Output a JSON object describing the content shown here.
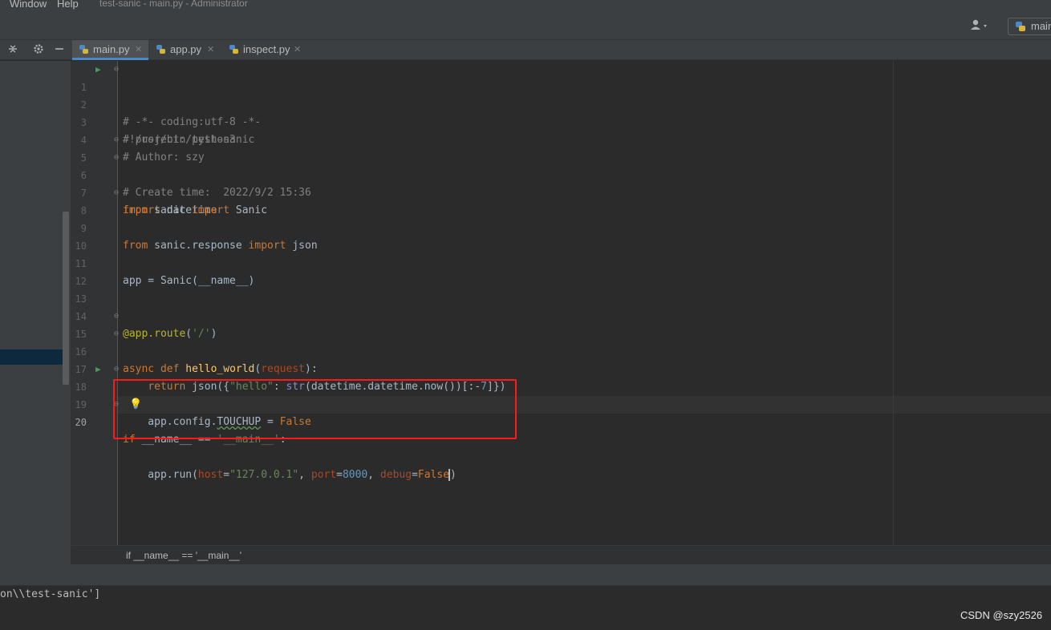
{
  "menu": {
    "window": "Window",
    "help": "Help"
  },
  "window_title": "test-sanic - main.py - Administrator",
  "toolbar": {
    "run_config": "main"
  },
  "tabs": [
    {
      "label": "main.py",
      "active": true
    },
    {
      "label": "app.py",
      "active": false
    },
    {
      "label": "inspect.py",
      "active": false
    }
  ],
  "editor": {
    "lines": [
      {
        "n": "1",
        "text": "#!/usr/bin/python3"
      },
      {
        "n": "2",
        "text": "# -*- coding:utf-8 -*-"
      },
      {
        "n": "3",
        "text": "# project: test-sanic"
      },
      {
        "n": "4",
        "text": "# Author: szy"
      },
      {
        "n": "5",
        "text": "# Create time:  2022/9/2 15:36"
      },
      {
        "n": "6",
        "text": "import datetime"
      },
      {
        "n": "7",
        "text": "from sanic import Sanic"
      },
      {
        "n": "8",
        "text": "from sanic.response import json"
      },
      {
        "n": "9",
        "text": ""
      },
      {
        "n": "10",
        "text": ""
      },
      {
        "n": "11",
        "text": "app = Sanic(__name__)"
      },
      {
        "n": "12",
        "text": ""
      },
      {
        "n": "13",
        "text": ""
      },
      {
        "n": "14",
        "text": "@app.route('/')"
      },
      {
        "n": "15",
        "text": "async def hello_world(request):"
      },
      {
        "n": "16",
        "text": "    return json({\"hello\": str(datetime.datetime.now())[:-7]})"
      },
      {
        "n": "17",
        "text": ""
      },
      {
        "n": "18",
        "text": "if __name__ == '__main__':"
      },
      {
        "n": "19",
        "text": "    app.config.TOUCHUP = False"
      },
      {
        "n": "20",
        "text": "    app.run(host=\"127.0.0.1\", port=8000, debug=False)"
      }
    ],
    "current_line": "20"
  },
  "breadcrumb": "if __name__ == '__main__'",
  "console": {
    "line": "on\\\\test-sanic']"
  },
  "watermark": "CSDN @szy2526",
  "colors": {
    "keyword": "#cc7832",
    "string": "#6a8759",
    "number": "#6897bb",
    "comment": "#808080",
    "function": "#ffc66d",
    "highlight_box": "#ff1a1a",
    "active_tab_underline": "#4a88c7"
  }
}
